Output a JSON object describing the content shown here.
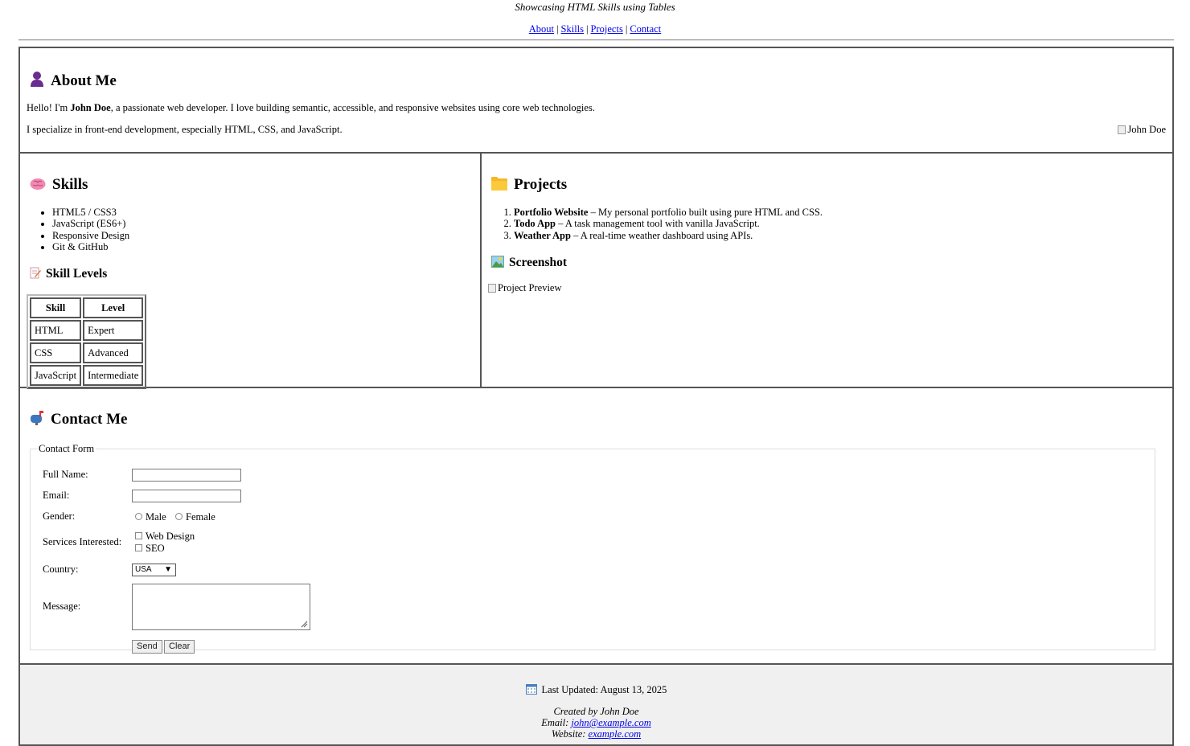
{
  "header": {
    "tagline": "Showcasing HTML Skills using Tables",
    "nav": [
      "About",
      "Skills",
      "Projects",
      "Contact"
    ],
    "nav_separator": "|"
  },
  "about": {
    "title": "About Me",
    "icon": "person-icon",
    "intro_pre": "Hello! I'm ",
    "name": "John Doe",
    "intro_post": ", a passionate web developer. I love building semantic, accessible, and responsive websites using core web technologies.",
    "specialize": "I specialize in front-end development, especially HTML, CSS, and JavaScript.",
    "photo_alt": "John Doe"
  },
  "skills": {
    "title": "Skills",
    "icon": "brain-icon",
    "items": [
      "HTML5 / CSS3",
      "JavaScript (ES6+)",
      "Responsive Design",
      "Git & GitHub"
    ],
    "levels_title": "Skill Levels",
    "levels_icon": "memo-icon",
    "table_headers": [
      "Skill",
      "Level"
    ],
    "table_rows": [
      [
        "HTML",
        "Expert"
      ],
      [
        "CSS",
        "Advanced"
      ],
      [
        "JavaScript",
        "Intermediate"
      ]
    ]
  },
  "projects": {
    "title": "Projects",
    "icon": "folder-icon",
    "items": [
      {
        "name": "Portfolio Website",
        "desc": " – My personal portfolio built using pure HTML and CSS."
      },
      {
        "name": "Todo App",
        "desc": " – A task management tool with vanilla JavaScript."
      },
      {
        "name": "Weather App",
        "desc": " – A real-time weather dashboard using APIs."
      }
    ],
    "screenshot_title": "Screenshot",
    "screenshot_icon": "picture-icon",
    "screenshot_alt": "Project Preview"
  },
  "contact": {
    "title": "Contact Me",
    "icon": "mailbox-icon",
    "legend": "Contact Form",
    "labels": {
      "full_name": "Full Name:",
      "email": "Email:",
      "gender": "Gender:",
      "services": "Services Interested:",
      "country": "Country:",
      "message": "Message:"
    },
    "full_name_value": "",
    "email_value": "",
    "gender_options": [
      "Male",
      "Female"
    ],
    "service_options": [
      "Web Design",
      "SEO"
    ],
    "country_selected": "USA",
    "message_value": "",
    "send_label": "Send",
    "clear_label": "Clear"
  },
  "footer": {
    "icon": "calendar-icon",
    "last_updated": "Last Updated: August 13, 2025",
    "created_by": "Created by John Doe",
    "email_label": "Email: ",
    "email": "john@example.com",
    "website_label": "Website: ",
    "website": "example.com"
  }
}
